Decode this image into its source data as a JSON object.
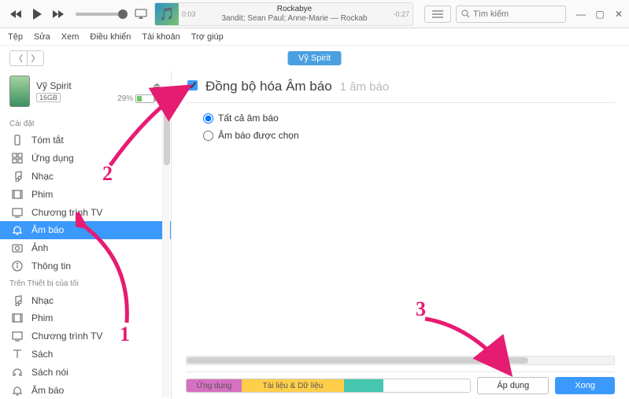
{
  "player": {
    "track_title": "Rockabye",
    "track_artist": "3andit; Sean Paul; Anne-Marie — Rockab",
    "time_elapsed": "0:03",
    "time_remain": "-0:27"
  },
  "search": {
    "placeholder": "Tìm kiếm"
  },
  "menu": {
    "file": "Tệp",
    "edit": "Sửa",
    "view": "Xem",
    "controls": "Điều khiển",
    "account": "Tài khoản",
    "help": "Trợ giúp"
  },
  "device": {
    "pill": "Vỹ Spirit",
    "name": "Vỹ Spirit",
    "capacity": "16GB",
    "battery_pct": "29%"
  },
  "sidebar": {
    "section_settings": "Cài đặt",
    "section_on_device": "Trên Thiết bị của tôi",
    "settings": [
      {
        "icon": "summary",
        "label": "Tóm tắt"
      },
      {
        "icon": "apps",
        "label": "Ứng dụng"
      },
      {
        "icon": "music",
        "label": "Nhạc"
      },
      {
        "icon": "movies",
        "label": "Phim"
      },
      {
        "icon": "tv",
        "label": "Chương trình TV"
      },
      {
        "icon": "tones",
        "label": "Âm báo"
      },
      {
        "icon": "photos",
        "label": "Ảnh"
      },
      {
        "icon": "info",
        "label": "Thông tin"
      }
    ],
    "on_device": [
      {
        "icon": "music",
        "label": "Nhạc"
      },
      {
        "icon": "movies",
        "label": "Phim"
      },
      {
        "icon": "tv",
        "label": "Chương trình TV"
      },
      {
        "icon": "books",
        "label": "Sách"
      },
      {
        "icon": "audiobooks",
        "label": "Sách nói"
      },
      {
        "icon": "tones",
        "label": "Âm báo"
      }
    ]
  },
  "sync": {
    "title": "Đồng bộ hóa Âm báo",
    "count": "1 âm báo",
    "opt_all": "Tất cả âm báo",
    "opt_selected": "Âm báo được chọn"
  },
  "usage": {
    "seg_apps": "Ứng dụng",
    "seg_data": "Tài liệu & Dữ liệu"
  },
  "buttons": {
    "apply": "Áp dụng",
    "done": "Xong"
  },
  "annotations": {
    "n1": "1",
    "n2": "2",
    "n3": "3"
  }
}
